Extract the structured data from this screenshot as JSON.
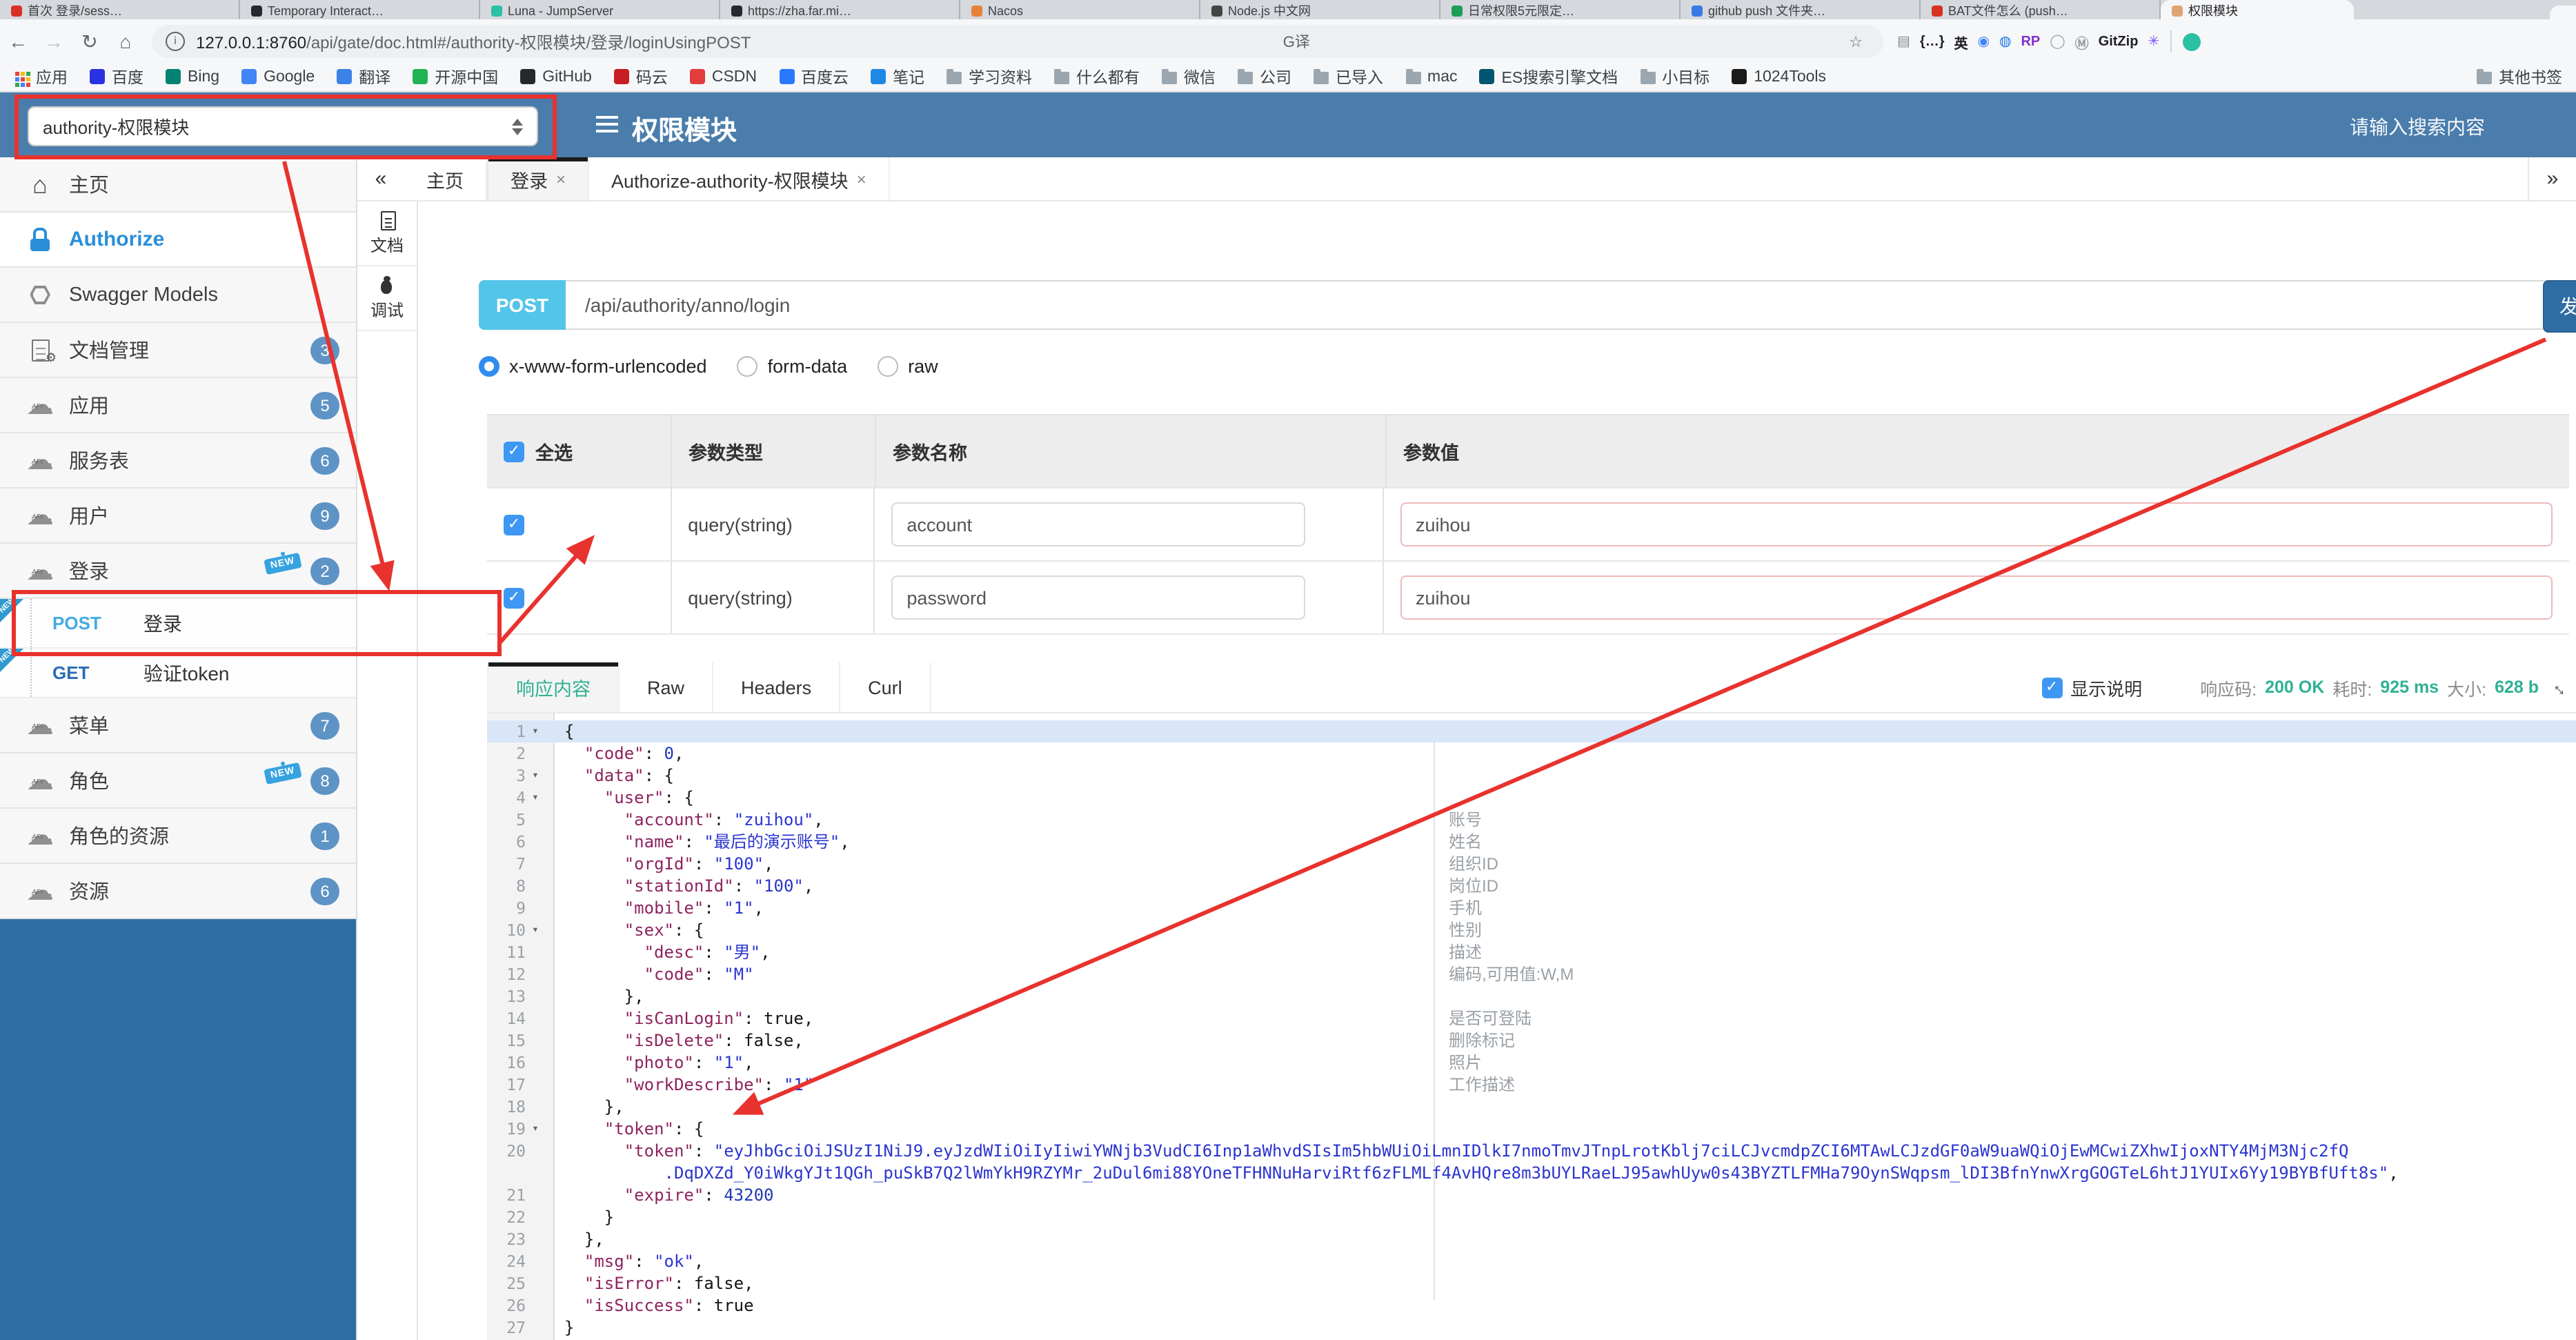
{
  "browser": {
    "tabs": [
      {
        "title": "首次 登录/sess…",
        "color": "#d93025"
      },
      {
        "title": "Temporary Interact…",
        "color": "#24292e"
      },
      {
        "title": "Luna - JumpServer",
        "color": "#2bbfa4"
      },
      {
        "title": "https://zha.far.mi…",
        "color": "#24292e"
      },
      {
        "title": "Nacos",
        "color": "#e8823a"
      },
      {
        "title": "Node.js 中文网",
        "color": "#444444"
      },
      {
        "title": "日常权限5元限定…",
        "color": "#1f9d55"
      },
      {
        "title": "github push 文件夹…",
        "color": "#3b78e7"
      },
      {
        "title": "BAT文件怎么 (push…",
        "color": "#d93025"
      }
    ],
    "active_tab": {
      "title": "权限模块",
      "color": "#e0a473"
    },
    "nav": {
      "back": "←",
      "forward": "→",
      "reload": "↻",
      "home": "⌂"
    },
    "url": {
      "info": "i",
      "host": "127.0.0.1:8760",
      "path": "/api/gate/doc.html#/authority-权限模块/登录/loginUsingPOST"
    },
    "pill_icons": {
      "translate": "G译",
      "star": "☆"
    },
    "extensions": [
      {
        "ch": "▤",
        "c": "#80868b"
      },
      {
        "ch": "{…}",
        "c": "#202124"
      },
      {
        "ch": "英",
        "c": "#202124"
      },
      {
        "ch": "◉",
        "c": "#4285f4"
      },
      {
        "ch": "◍",
        "c": "#1a73e8"
      },
      {
        "ch": "RP",
        "c": "#8430ce"
      },
      {
        "ch": "◯",
        "c": "#9aa0a6"
      },
      {
        "ch": "Ⓜ",
        "c": "#9aa0a6"
      },
      {
        "ch": "GitZip",
        "c": "#202124"
      },
      {
        "ch": "✳",
        "c": "#7c4dff"
      }
    ],
    "bookmarks": [
      {
        "label": "应用",
        "ic": "apps",
        "c": "#4285f4"
      },
      {
        "label": "百度",
        "ic": "site",
        "c": "#2932e1"
      },
      {
        "label": "Bing",
        "ic": "site",
        "c": "#008373"
      },
      {
        "label": "Google",
        "ic": "site",
        "c": "#4285f4"
      },
      {
        "label": "翻译",
        "ic": "site",
        "c": "#3b82e8"
      },
      {
        "label": "开源中国",
        "ic": "site",
        "c": "#21b351"
      },
      {
        "label": "GitHub",
        "ic": "site",
        "c": "#24292e"
      },
      {
        "label": "码云",
        "ic": "site",
        "c": "#c71d23"
      },
      {
        "label": "CSDN",
        "ic": "site",
        "c": "#e23c3c"
      },
      {
        "label": "百度云",
        "ic": "site",
        "c": "#2979ff"
      },
      {
        "label": "笔记",
        "ic": "site",
        "c": "#1e88e5"
      },
      {
        "label": "学习资料",
        "ic": "folder",
        "c": "#9aa6b0"
      },
      {
        "label": "什么都有",
        "ic": "folder",
        "c": "#9aa6b0"
      },
      {
        "label": "微信",
        "ic": "folder",
        "c": "#9aa6b0"
      },
      {
        "label": "公司",
        "ic": "folder",
        "c": "#9aa6b0"
      },
      {
        "label": "已导入",
        "ic": "folder",
        "c": "#9aa6b0"
      },
      {
        "label": "mac",
        "ic": "folder",
        "c": "#9aa6b0"
      },
      {
        "label": "ES搜索引擎文档",
        "ic": "site",
        "c": "#005571"
      },
      {
        "label": "小目标",
        "ic": "folder",
        "c": "#9aa6b0"
      },
      {
        "label": "1024Tools",
        "ic": "site",
        "c": "#1a1a1a"
      }
    ],
    "bookmarks_right": {
      "label": "其他书签",
      "ic": "folder",
      "c": "#9aa6b0"
    }
  },
  "header": {
    "module_select": "authority-权限模块",
    "title": "权限模块",
    "search_placeholder": "请输入搜索内容"
  },
  "sidebar": {
    "items": [
      {
        "isnav": true,
        "ic": "home",
        "label": "主页"
      },
      {
        "isnav": true,
        "ic": "lock",
        "label": "Authorize",
        "auth": true
      },
      {
        "isnav": true,
        "ic": "hex",
        "label": "Swagger Models"
      },
      {
        "isnav": true,
        "ic": "docgear",
        "label": "文档管理",
        "badge": "3"
      },
      {
        "isnav": true,
        "ic": "api",
        "label": "应用",
        "badge": "5"
      },
      {
        "isnav": true,
        "ic": "api",
        "label": "服务表",
        "badge": "6"
      },
      {
        "isnav": true,
        "ic": "api",
        "label": "用户",
        "badge": "9"
      },
      {
        "isnav": true,
        "ic": "api",
        "label": "登录",
        "badge": "2",
        "isnew": true
      },
      {
        "isop": true,
        "method": "POST",
        "mc": "#45aae2",
        "label": "登录",
        "isnew": true
      },
      {
        "isop": true,
        "method": "GET",
        "mc": "#2b6cb3",
        "label": "验证token",
        "isnew": true
      },
      {
        "isnav": true,
        "ic": "api",
        "label": "菜单",
        "badge": "7"
      },
      {
        "isnav": true,
        "ic": "api",
        "label": "角色",
        "badge": "8",
        "isnew": true
      },
      {
        "isnav": true,
        "ic": "api",
        "label": "角色的资源",
        "badge": "1"
      },
      {
        "isnav": true,
        "ic": "api",
        "label": "资源",
        "badge": "6"
      }
    ],
    "new_tag": "NEW"
  },
  "doc_tabs": {
    "collapse": "«",
    "expand": "»",
    "tabs": [
      {
        "label": "主页"
      },
      {
        "label": "登录",
        "close": "×",
        "active": true
      },
      {
        "label": "Authorize-authority-权限模块",
        "close": "×"
      }
    ]
  },
  "side_tabs": [
    {
      "ic": "doc",
      "label": "文档"
    },
    {
      "ic": "bug",
      "label": "调试",
      "active": true
    }
  ],
  "debug": {
    "method": "POST",
    "url": "/api/authority/anno/login",
    "send_label": "发",
    "body_types": [
      {
        "label": "x-www-form-urlencoded",
        "checked": true
      },
      {
        "label": "form-data"
      },
      {
        "label": "raw"
      }
    ],
    "table": {
      "check_all": "全选",
      "col_type": "参数类型",
      "col_name": "参数名称",
      "col_value": "参数值",
      "rows": [
        {
          "type": "query(string)",
          "name": "account",
          "value": "zuihou"
        },
        {
          "type": "query(string)",
          "name": "password",
          "value": "zuihou"
        }
      ]
    },
    "resp_tabs": [
      {
        "label": "响应内容",
        "active": true
      },
      {
        "label": "Raw"
      },
      {
        "label": "Headers"
      },
      {
        "label": "Curl"
      }
    ],
    "meta": {
      "show_desc": "显示说明",
      "code_label": "响应码:",
      "code": "200 OK",
      "time_label": "耗时:",
      "time": "925 ms",
      "size_label": "大小:",
      "size": "628 b"
    }
  },
  "editor": {
    "fold_glyph": "▾",
    "lines": [
      {
        "n": "1",
        "fold": true,
        "hl": true,
        "seg": [
          {
            "t": "p",
            "v": "{"
          }
        ]
      },
      {
        "n": "2",
        "seg": [
          {
            "t": "p",
            "v": "  "
          },
          {
            "t": "k",
            "v": "\"code\""
          },
          {
            "t": "p",
            "v": ": "
          },
          {
            "t": "n",
            "v": "0"
          },
          {
            "t": "p",
            "v": ","
          }
        ]
      },
      {
        "n": "3",
        "fold": true,
        "seg": [
          {
            "t": "p",
            "v": "  "
          },
          {
            "t": "k",
            "v": "\"data\""
          },
          {
            "t": "p",
            "v": ": {"
          }
        ]
      },
      {
        "n": "4",
        "fold": true,
        "seg": [
          {
            "t": "p",
            "v": "    "
          },
          {
            "t": "k",
            "v": "\"user\""
          },
          {
            "t": "p",
            "v": ": {"
          }
        ]
      },
      {
        "n": "5",
        "note": "账号",
        "seg": [
          {
            "t": "p",
            "v": "      "
          },
          {
            "t": "k",
            "v": "\"account\""
          },
          {
            "t": "p",
            "v": ": "
          },
          {
            "t": "s",
            "v": "\"zuihou\""
          },
          {
            "t": "p",
            "v": ","
          }
        ]
      },
      {
        "n": "6",
        "note": "姓名",
        "seg": [
          {
            "t": "p",
            "v": "      "
          },
          {
            "t": "k",
            "v": "\"name\""
          },
          {
            "t": "p",
            "v": ": "
          },
          {
            "t": "s",
            "v": "\"最后的演示账号\""
          },
          {
            "t": "p",
            "v": ","
          }
        ]
      },
      {
        "n": "7",
        "note": "组织ID",
        "seg": [
          {
            "t": "p",
            "v": "      "
          },
          {
            "t": "k",
            "v": "\"orgId\""
          },
          {
            "t": "p",
            "v": ": "
          },
          {
            "t": "s",
            "v": "\"100\""
          },
          {
            "t": "p",
            "v": ","
          }
        ]
      },
      {
        "n": "8",
        "note": "岗位ID",
        "seg": [
          {
            "t": "p",
            "v": "      "
          },
          {
            "t": "k",
            "v": "\"stationId\""
          },
          {
            "t": "p",
            "v": ": "
          },
          {
            "t": "s",
            "v": "\"100\""
          },
          {
            "t": "p",
            "v": ","
          }
        ]
      },
      {
        "n": "9",
        "note": "手机",
        "seg": [
          {
            "t": "p",
            "v": "      "
          },
          {
            "t": "k",
            "v": "\"mobile\""
          },
          {
            "t": "p",
            "v": ": "
          },
          {
            "t": "s",
            "v": "\"1\""
          },
          {
            "t": "p",
            "v": ","
          }
        ]
      },
      {
        "n": "10",
        "fold": true,
        "note": "性别",
        "seg": [
          {
            "t": "p",
            "v": "      "
          },
          {
            "t": "k",
            "v": "\"sex\""
          },
          {
            "t": "p",
            "v": ": {"
          }
        ]
      },
      {
        "n": "11",
        "note": "描述",
        "seg": [
          {
            "t": "p",
            "v": "        "
          },
          {
            "t": "k",
            "v": "\"desc\""
          },
          {
            "t": "p",
            "v": ": "
          },
          {
            "t": "s",
            "v": "\"男\""
          },
          {
            "t": "p",
            "v": ","
          }
        ]
      },
      {
        "n": "12",
        "note": "编码,可用值:W,M",
        "seg": [
          {
            "t": "p",
            "v": "        "
          },
          {
            "t": "k",
            "v": "\"code\""
          },
          {
            "t": "p",
            "v": ": "
          },
          {
            "t": "s",
            "v": "\"M\""
          }
        ]
      },
      {
        "n": "13",
        "seg": [
          {
            "t": "p",
            "v": "      },"
          }
        ]
      },
      {
        "n": "14",
        "note": "是否可登陆",
        "seg": [
          {
            "t": "p",
            "v": "      "
          },
          {
            "t": "k",
            "v": "\"isCanLogin\""
          },
          {
            "t": "p",
            "v": ": "
          },
          {
            "t": "b",
            "v": "true"
          },
          {
            "t": "p",
            "v": ","
          }
        ]
      },
      {
        "n": "15",
        "note": "删除标记",
        "seg": [
          {
            "t": "p",
            "v": "      "
          },
          {
            "t": "k",
            "v": "\"isDelete\""
          },
          {
            "t": "p",
            "v": ": "
          },
          {
            "t": "b",
            "v": "false"
          },
          {
            "t": "p",
            "v": ","
          }
        ]
      },
      {
        "n": "16",
        "note": "照片",
        "seg": [
          {
            "t": "p",
            "v": "      "
          },
          {
            "t": "k",
            "v": "\"photo\""
          },
          {
            "t": "p",
            "v": ": "
          },
          {
            "t": "s",
            "v": "\"1\""
          },
          {
            "t": "p",
            "v": ","
          }
        ]
      },
      {
        "n": "17",
        "note": "工作描述",
        "seg": [
          {
            "t": "p",
            "v": "      "
          },
          {
            "t": "k",
            "v": "\"workDescribe\""
          },
          {
            "t": "p",
            "v": ": "
          },
          {
            "t": "s",
            "v": "\"1\""
          }
        ]
      },
      {
        "n": "18",
        "seg": [
          {
            "t": "p",
            "v": "    },"
          }
        ]
      },
      {
        "n": "19",
        "fold": true,
        "seg": [
          {
            "t": "p",
            "v": "    "
          },
          {
            "t": "k",
            "v": "\"token\""
          },
          {
            "t": "p",
            "v": ": {"
          }
        ]
      },
      {
        "n": "20",
        "seg": [
          {
            "t": "p",
            "v": "      "
          },
          {
            "t": "k",
            "v": "\"token\""
          },
          {
            "t": "p",
            "v": ": "
          },
          {
            "t": "s",
            "v": "\"eyJhbGciOiJSUzI1NiJ9.eyJzdWIiOiIyIiwiYWNjb3VudCI6Inp1aWhvdSIsIm5hbWUiOiLmnIDlkI7nmoTmvJTnpLrotKblj7ciLCJvcmdpZCI6MTAwLCJzdGF0aW9uaWQiOjEwMCwiZXhwIjoxNTY4MjM3Njc2fQ"
          }
        ]
      },
      {
        "n": "",
        "seg": [
          {
            "t": "s",
            "v": "          .DqDXZd_Y0iWkgYJt1QGh_puSkB7Q2lWmYkH9RZYMr_2uDul6mi88YOneTFHNNuHarviRtf6zFLMLf4AvHQre8m3bUYLRaeLJ95awhUyw0s43BYZTLFMHa79OynSWqpsm_lDI3BfnYnwXrgGOGTeL6htJ1YUIx6Yy19BYBfUft8s\""
          },
          {
            "t": "p",
            "v": ","
          }
        ]
      },
      {
        "n": "21",
        "seg": [
          {
            "t": "p",
            "v": "      "
          },
          {
            "t": "k",
            "v": "\"expire\""
          },
          {
            "t": "p",
            "v": ": "
          },
          {
            "t": "n",
            "v": "43200"
          }
        ]
      },
      {
        "n": "22",
        "seg": [
          {
            "t": "p",
            "v": "    }"
          }
        ]
      },
      {
        "n": "23",
        "seg": [
          {
            "t": "p",
            "v": "  },"
          }
        ]
      },
      {
        "n": "24",
        "seg": [
          {
            "t": "p",
            "v": "  "
          },
          {
            "t": "k",
            "v": "\"msg\""
          },
          {
            "t": "p",
            "v": ": "
          },
          {
            "t": "s",
            "v": "\"ok\""
          },
          {
            "t": "p",
            "v": ","
          }
        ]
      },
      {
        "n": "25",
        "seg": [
          {
            "t": "p",
            "v": "  "
          },
          {
            "t": "k",
            "v": "\"isError\""
          },
          {
            "t": "p",
            "v": ": "
          },
          {
            "t": "b",
            "v": "false"
          },
          {
            "t": "p",
            "v": ","
          }
        ]
      },
      {
        "n": "26",
        "seg": [
          {
            "t": "p",
            "v": "  "
          },
          {
            "t": "k",
            "v": "\"isSuccess\""
          },
          {
            "t": "p",
            "v": ": "
          },
          {
            "t": "b",
            "v": "true"
          }
        ]
      },
      {
        "n": "27",
        "seg": [
          {
            "t": "p",
            "v": "}"
          }
        ]
      }
    ]
  },
  "annotation_color": "#e8322e"
}
